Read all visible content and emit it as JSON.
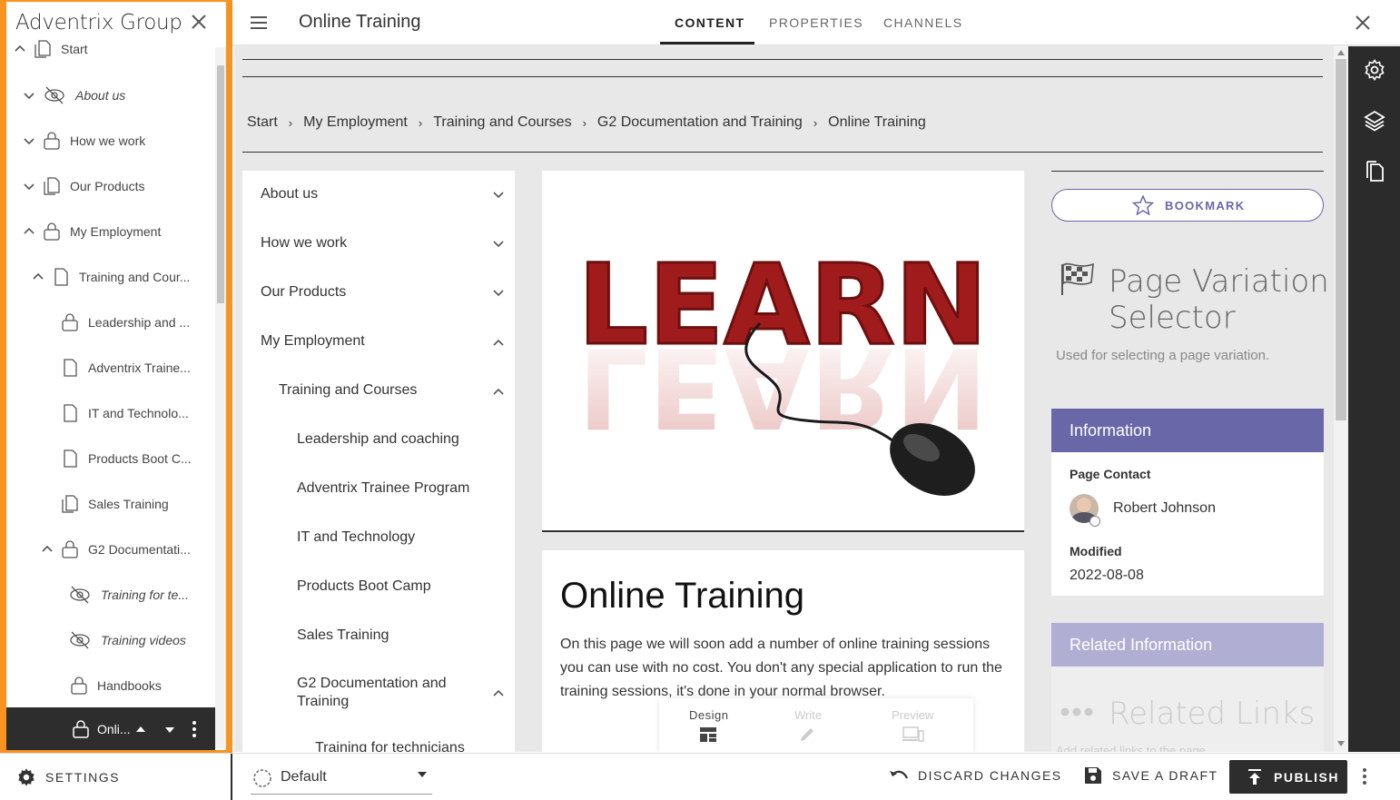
{
  "tree": {
    "title": "Adventrix Group",
    "items": [
      {
        "label": "Start"
      },
      {
        "label": "About us"
      },
      {
        "label": "How we work"
      },
      {
        "label": "Our Products"
      },
      {
        "label": "My Employment"
      },
      {
        "label": "Training and Cour..."
      },
      {
        "label": "Leadership and ..."
      },
      {
        "label": "Adventrix Traine..."
      },
      {
        "label": "IT and Technolo..."
      },
      {
        "label": "Products Boot C..."
      },
      {
        "label": "Sales Training"
      },
      {
        "label": "G2 Documentati..."
      },
      {
        "label": "Training for te..."
      },
      {
        "label": "Training videos"
      },
      {
        "label": "Handbooks"
      },
      {
        "label": "Onli..."
      }
    ]
  },
  "header": {
    "page_title": "Online Training",
    "tabs": [
      {
        "label": "CONTENT"
      },
      {
        "label": "PROPERTIES"
      },
      {
        "label": "CHANNELS"
      }
    ]
  },
  "breadcrumb": [
    "Start",
    "My Employment",
    "Training and Courses",
    "G2 Documentation and Training",
    "Online Training"
  ],
  "side_menu": [
    {
      "label": "About us"
    },
    {
      "label": "How we work"
    },
    {
      "label": "Our Products"
    },
    {
      "label": "My Employment"
    },
    {
      "label": "Training and Courses"
    },
    {
      "label": "Leadership and coaching"
    },
    {
      "label": "Adventrix Trainee Program"
    },
    {
      "label": "IT and Technology"
    },
    {
      "label": "Products Boot Camp"
    },
    {
      "label": "Sales Training"
    },
    {
      "label": "G2 Documentation and Training"
    },
    {
      "label": "Training for technicians"
    }
  ],
  "hero": {
    "image_text": "LEARN"
  },
  "article": {
    "title": "Online Training",
    "body": "On this page we will soon add a number of online training sessions you can use with no cost. You don't any special application to run the training sessions, it's done in your normal browser."
  },
  "view_modes": [
    {
      "label": "Design"
    },
    {
      "label": "Write"
    },
    {
      "label": "Preview"
    }
  ],
  "right_col": {
    "bookmark": "BOOKMARK",
    "pvs_title_1": "Page Variation",
    "pvs_title_2": "Selector",
    "pvs_desc": "Used for selecting a page variation.",
    "info_header": "Information",
    "page_contact_label": "Page Contact",
    "contact_name": "Robert Johnson",
    "modified_label": "Modified",
    "modified_value": "2022-08-08",
    "related_header": "Related Information",
    "related_links": "Related Links",
    "related_hint": "Add related links to the page"
  },
  "bottom": {
    "settings": "SETTINGS",
    "variant": "Default",
    "discard": "DISCARD CHANGES",
    "save_draft": "SAVE A DRAFT",
    "publish": "PUBLISH"
  },
  "colors": {
    "accent_orange": "#f7931e",
    "info_purple": "#6a67a8",
    "related_purple": "#b1aed4"
  }
}
